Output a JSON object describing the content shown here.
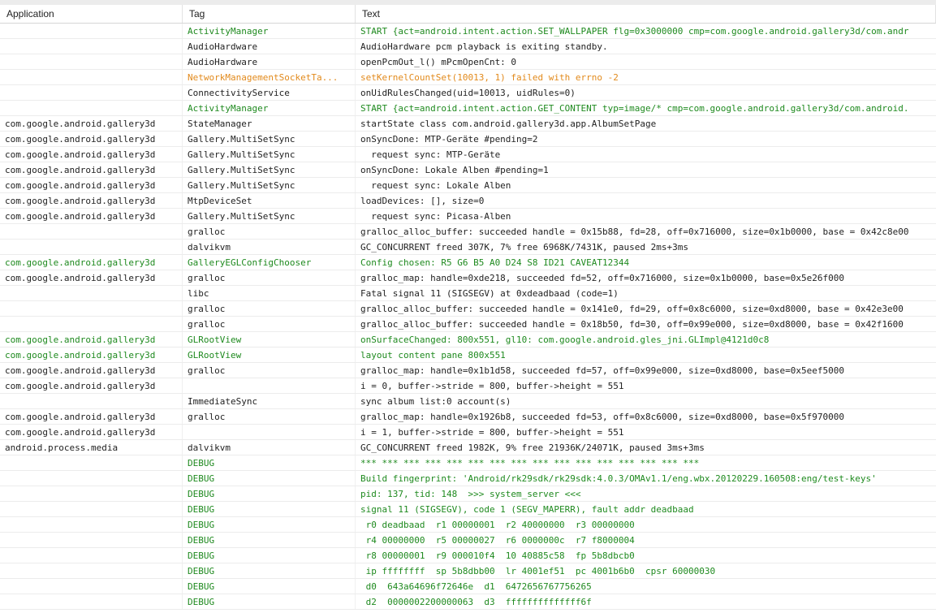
{
  "header": {
    "application": "Application",
    "tag": "Tag",
    "text": "Text"
  },
  "colors": {
    "V": "#222222",
    "D": "#1f8a1f",
    "I": "#1f8a1f",
    "W": "#e28a1c",
    "E": "#cc2222"
  },
  "rows": [
    {
      "app": "",
      "tag": "ActivityManager",
      "text": "START {act=android.intent.action.SET_WALLPAPER flg=0x3000000 cmp=com.google.android.gallery3d/com.andr",
      "level": "I"
    },
    {
      "app": "",
      "tag": "AudioHardware",
      "text": "AudioHardware pcm playback is exiting standby.",
      "level": "V"
    },
    {
      "app": "",
      "tag": "AudioHardware",
      "text": "openPcmOut_l() mPcmOpenCnt: 0",
      "level": "V"
    },
    {
      "app": "",
      "tag": "NetworkManagementSocketTa...",
      "text": "setKernelCountSet(10013, 1) failed with errno -2",
      "level": "W"
    },
    {
      "app": "",
      "tag": "ConnectivityService",
      "text": "onUidRulesChanged(uid=10013, uidRules=0)",
      "level": "V"
    },
    {
      "app": "",
      "tag": "ActivityManager",
      "text": "START {act=android.intent.action.GET_CONTENT typ=image/* cmp=com.google.android.gallery3d/com.android.",
      "level": "I"
    },
    {
      "app": "com.google.android.gallery3d",
      "tag": "StateManager",
      "text": "startState class com.android.gallery3d.app.AlbumSetPage",
      "level": "V"
    },
    {
      "app": "com.google.android.gallery3d",
      "tag": "Gallery.MultiSetSync",
      "text": "onSyncDone: MTP-Geräte #pending=2",
      "level": "V"
    },
    {
      "app": "com.google.android.gallery3d",
      "tag": "Gallery.MultiSetSync",
      "text": "  request sync: MTP-Geräte",
      "level": "V"
    },
    {
      "app": "com.google.android.gallery3d",
      "tag": "Gallery.MultiSetSync",
      "text": "onSyncDone: Lokale Alben #pending=1",
      "level": "V"
    },
    {
      "app": "com.google.android.gallery3d",
      "tag": "Gallery.MultiSetSync",
      "text": "  request sync: Lokale Alben",
      "level": "V"
    },
    {
      "app": "com.google.android.gallery3d",
      "tag": "MtpDeviceSet",
      "text": "loadDevices: [], size=0",
      "level": "V"
    },
    {
      "app": "com.google.android.gallery3d",
      "tag": "Gallery.MultiSetSync",
      "text": "  request sync: Picasa-Alben",
      "level": "V"
    },
    {
      "app": "",
      "tag": "gralloc",
      "text": "gralloc_alloc_buffer: succeeded handle = 0x15b88, fd=28, off=0x716000, size=0x1b0000, base = 0x42c8e00",
      "level": "V"
    },
    {
      "app": "",
      "tag": "dalvikvm",
      "text": "GC_CONCURRENT freed 307K, 7% free 6968K/7431K, paused 2ms+3ms",
      "level": "V"
    },
    {
      "app": "com.google.android.gallery3d",
      "tag": "GalleryEGLConfigChooser",
      "text": "Config chosen: R5 G6 B5 A0 D24 S8 ID21 CAVEAT12344",
      "level": "D"
    },
    {
      "app": "com.google.android.gallery3d",
      "tag": "gralloc",
      "text": "gralloc_map: handle=0xde218, succeeded fd=52, off=0x716000, size=0x1b0000, base=0x5e26f000",
      "level": "V"
    },
    {
      "app": "",
      "tag": "libc",
      "text": "Fatal signal 11 (SIGSEGV) at 0xdeadbaad (code=1)",
      "level": "V"
    },
    {
      "app": "",
      "tag": "gralloc",
      "text": "gralloc_alloc_buffer: succeeded handle = 0x141e0, fd=29, off=0x8c6000, size=0xd8000, base = 0x42e3e00",
      "level": "V"
    },
    {
      "app": "",
      "tag": "gralloc",
      "text": "gralloc_alloc_buffer: succeeded handle = 0x18b50, fd=30, off=0x99e000, size=0xd8000, base = 0x42f1600",
      "level": "V"
    },
    {
      "app": "com.google.android.gallery3d",
      "tag": "GLRootView",
      "text": "onSurfaceChanged: 800x551, gl10: com.google.android.gles_jni.GLImpl@4121d0c8",
      "level": "D"
    },
    {
      "app": "com.google.android.gallery3d",
      "tag": "GLRootView",
      "text": "layout content pane 800x551",
      "level": "D"
    },
    {
      "app": "com.google.android.gallery3d",
      "tag": "gralloc",
      "text": "gralloc_map: handle=0x1b1d58, succeeded fd=57, off=0x99e000, size=0xd8000, base=0x5eef5000",
      "level": "V"
    },
    {
      "app": "com.google.android.gallery3d",
      "tag": "",
      "text": "i = 0, buffer->stride = 800, buffer->height = 551",
      "level": "V"
    },
    {
      "app": "",
      "tag": "ImmediateSync",
      "text": "sync album list:0 account(s)",
      "level": "V"
    },
    {
      "app": "com.google.android.gallery3d",
      "tag": "gralloc",
      "text": "gralloc_map: handle=0x1926b8, succeeded fd=53, off=0x8c6000, size=0xd8000, base=0x5f970000",
      "level": "V"
    },
    {
      "app": "com.google.android.gallery3d",
      "tag": "",
      "text": "i = 1, buffer->stride = 800, buffer->height = 551",
      "level": "V"
    },
    {
      "app": "android.process.media",
      "tag": "dalvikvm",
      "text": "GC_CONCURRENT freed 1982K, 9% free 21936K/24071K, paused 3ms+3ms",
      "level": "V"
    },
    {
      "app": "",
      "tag": "DEBUG",
      "text": "*** *** *** *** *** *** *** *** *** *** *** *** *** *** *** ***",
      "level": "I"
    },
    {
      "app": "",
      "tag": "DEBUG",
      "text": "Build fingerprint: 'Android/rk29sdk/rk29sdk:4.0.3/OMAv1.1/eng.wbx.20120229.160508:eng/test-keys'",
      "level": "I"
    },
    {
      "app": "",
      "tag": "DEBUG",
      "text": "pid: 137, tid: 148  >>> system_server <<<",
      "level": "I"
    },
    {
      "app": "",
      "tag": "DEBUG",
      "text": "signal 11 (SIGSEGV), code 1 (SEGV_MAPERR), fault addr deadbaad",
      "level": "I"
    },
    {
      "app": "",
      "tag": "DEBUG",
      "text": " r0 deadbaad  r1 00000001  r2 40000000  r3 00000000",
      "level": "I"
    },
    {
      "app": "",
      "tag": "DEBUG",
      "text": " r4 00000000  r5 00000027  r6 0000000c  r7 f8000004",
      "level": "I"
    },
    {
      "app": "",
      "tag": "DEBUG",
      "text": " r8 00000001  r9 000010f4  10 40885c58  fp 5b8dbcb0",
      "level": "I"
    },
    {
      "app": "",
      "tag": "DEBUG",
      "text": " ip ffffffff  sp 5b8dbb00  lr 4001ef51  pc 4001b6b0  cpsr 60000030",
      "level": "I"
    },
    {
      "app": "",
      "tag": "DEBUG",
      "text": " d0  643a64696f72646e  d1  6472656767756265",
      "level": "I"
    },
    {
      "app": "",
      "tag": "DEBUG",
      "text": " d2  0000002200000063  d3  ffffffffffffff6f",
      "level": "I"
    }
  ]
}
